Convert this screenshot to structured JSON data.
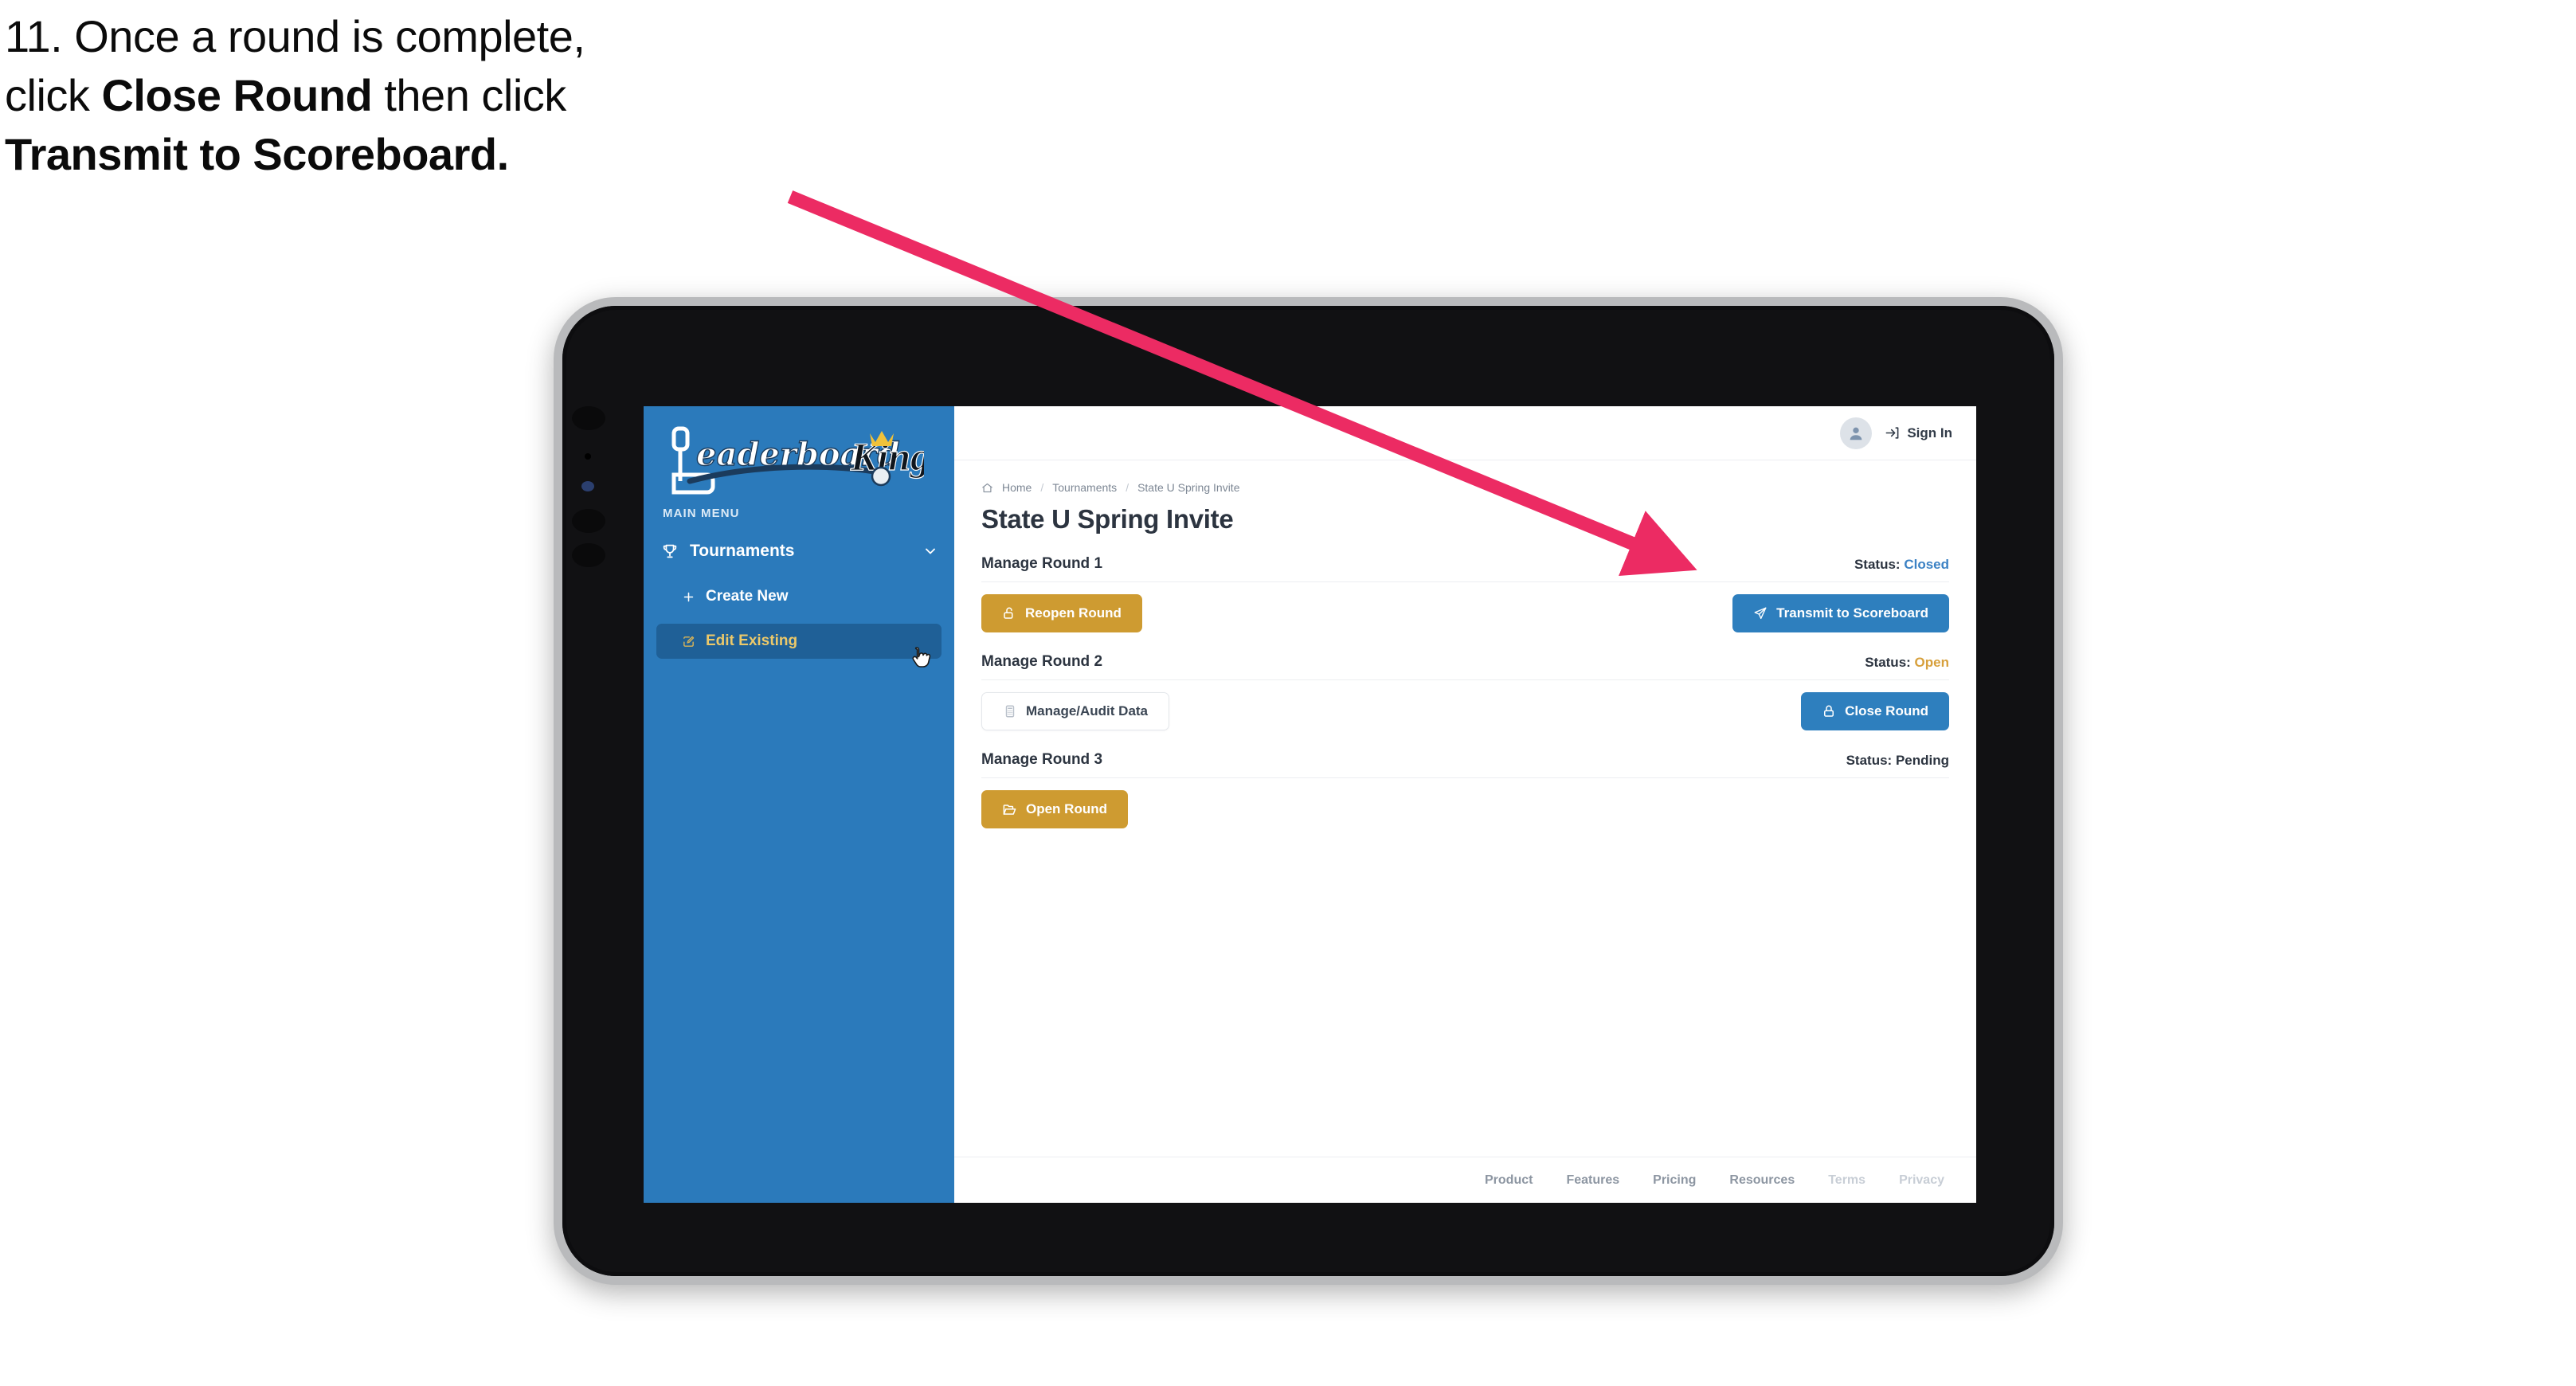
{
  "caption": {
    "line1_pre": "11. Once a round is complete,",
    "line2_pre": "click ",
    "line2_bold": "Close Round",
    "line2_post": " then click",
    "line3_bold": "Transmit to Scoreboard."
  },
  "sidebar": {
    "logo_text": "LeaderboardKing",
    "logo_word1": "eaderboard",
    "logo_word2": "King",
    "menu_label": "MAIN MENU",
    "items": [
      {
        "label": "Tournaments",
        "icon": "trophy-icon",
        "chevron": "chevron-down-icon"
      },
      {
        "label": "Create New",
        "icon": "plus-icon"
      },
      {
        "label": "Edit Existing",
        "icon": "edit-square-icon",
        "active": true
      }
    ]
  },
  "topbar": {
    "avatar_icon": "user-avatar-icon",
    "signin_label": "Sign In",
    "signin_icon": "login-arrow-icon"
  },
  "breadcrumb": {
    "home_icon": "home-icon",
    "items": [
      "Home",
      "Tournaments",
      "State U Spring Invite"
    ],
    "separator": "/"
  },
  "page_title": "State U Spring Invite",
  "rounds": [
    {
      "name": "Manage Round 1",
      "status_label": "Status:",
      "status_value": "Closed",
      "status_kind": "closed",
      "left_button": {
        "label": "Reopen Round",
        "icon": "unlock-icon",
        "style": "gold"
      },
      "right_button": {
        "label": "Transmit to Scoreboard",
        "icon": "paper-plane-icon",
        "style": "blue"
      }
    },
    {
      "name": "Manage Round 2",
      "status_label": "Status:",
      "status_value": "Open",
      "status_kind": "open",
      "left_button": {
        "label": "Manage/Audit Data",
        "icon": "calculator-icon",
        "style": "ghost"
      },
      "right_button": {
        "label": "Close Round",
        "icon": "lock-icon",
        "style": "blue"
      }
    },
    {
      "name": "Manage Round 3",
      "status_label": "Status:",
      "status_value": "Pending",
      "status_kind": "pending",
      "left_button": {
        "label": "Open Round",
        "icon": "open-folder-icon",
        "style": "gold"
      },
      "right_button": null
    }
  ],
  "footer": {
    "links": [
      "Product",
      "Features",
      "Pricing",
      "Resources"
    ],
    "muted_links": [
      "Terms",
      "Privacy"
    ]
  },
  "colors": {
    "sidebar_blue": "#2b7abb",
    "accent_blue": "#2e7fbe",
    "accent_gold": "#ce9b31",
    "status_closed": "#3c82c4",
    "status_open": "#d7a03c",
    "annotation_pink": "#ec2b63",
    "text_dark": "#2c3440"
  },
  "annotation": {
    "arrow_color": "#ec2b63",
    "points_to": "Transmit to Scoreboard"
  },
  "cursor": {
    "type": "pointer-hand-cursor"
  }
}
